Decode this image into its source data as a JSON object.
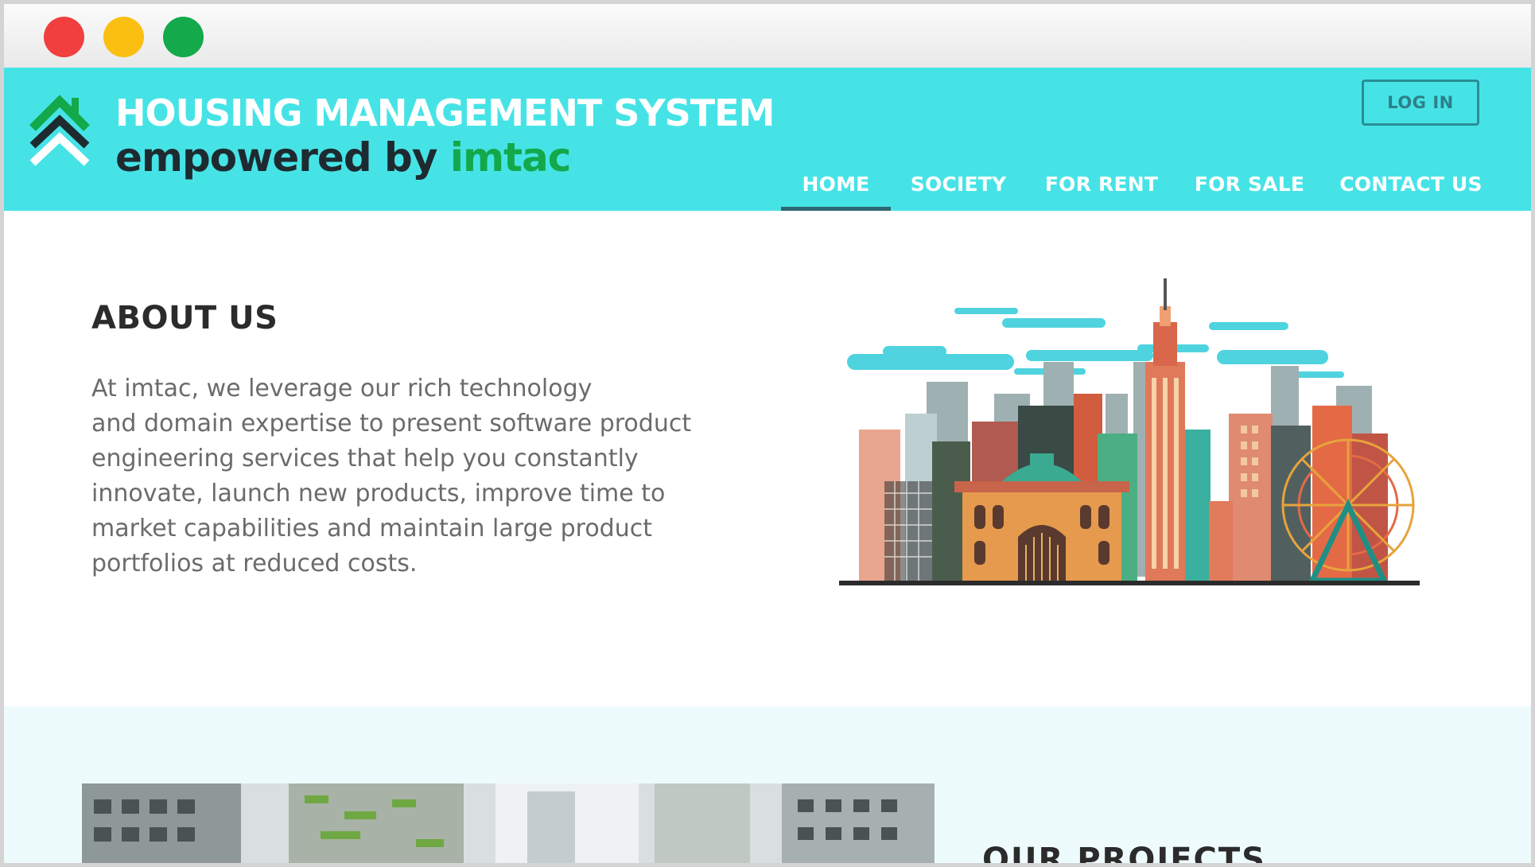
{
  "window": {
    "controls": [
      "close",
      "minimize",
      "maximize"
    ],
    "colors": {
      "close": "#f13f3f",
      "minimize": "#fbbf12",
      "maximize": "#14a94b"
    }
  },
  "header": {
    "title": "HOUSING MANAGEMENT SYSTEM",
    "subtitle_prefix": "empowered by ",
    "subtitle_brand": "imtac",
    "logo_icon": "house-chevron-logo",
    "login_label": "LOG IN",
    "background_color": "#46e3e6",
    "accent_color": "#13a84a"
  },
  "nav": {
    "items": [
      {
        "label": "HOME",
        "active": true
      },
      {
        "label": "SOCIETY",
        "active": false
      },
      {
        "label": "FOR RENT",
        "active": false
      },
      {
        "label": "FOR SALE",
        "active": false
      },
      {
        "label": "CONTACT US",
        "active": false
      }
    ]
  },
  "about": {
    "heading": "ABOUT US",
    "lines": [
      "At imtac, we leverage our rich technology",
      "and domain expertise to present software product",
      "engineering services that help you constantly",
      "innovate, launch new products, improve time to",
      "market capabilities and maintain large product",
      "portfolios at reduced costs."
    ],
    "illustration": "city-skyline-illustration"
  },
  "projects": {
    "heading": "OUR PROJECTS",
    "image": "projects-building-image"
  }
}
